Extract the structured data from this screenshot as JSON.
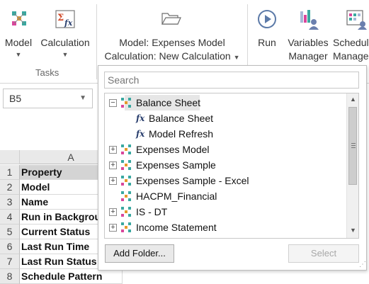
{
  "ribbon": {
    "model_button": {
      "label": "Model",
      "icon": "model-icon"
    },
    "calculation_button": {
      "label": "Calculation",
      "icon": "calculation-sigma-fx-icon"
    },
    "group_tasks_label": "Tasks",
    "selector": {
      "line1": "Model: Expenses Model",
      "line2": "Calculation: New Calculation",
      "icon": "folder-open-icon"
    },
    "run_button": {
      "label": "Run",
      "icon": "play-circle-icon"
    },
    "variables_manager_button": {
      "line1": "Variables",
      "line2": "Manager",
      "icon": "variables-icon"
    },
    "schedule_manager_button": {
      "line1": "Schedule",
      "line2": "Manager",
      "icon": "schedule-icon"
    }
  },
  "namebox": {
    "value": "B5"
  },
  "sheet": {
    "column_header": "A",
    "rows": [
      {
        "num": "1",
        "value": "Property",
        "highlight": true
      },
      {
        "num": "2",
        "value": "Model"
      },
      {
        "num": "3",
        "value": "Name"
      },
      {
        "num": "4",
        "value": "Run in Background"
      },
      {
        "num": "5",
        "value": "Current Status"
      },
      {
        "num": "6",
        "value": "Last Run Time"
      },
      {
        "num": "7",
        "value": "Last Run Status"
      },
      {
        "num": "8",
        "value": "Schedule Pattern"
      }
    ]
  },
  "popup": {
    "search_placeholder": "Search",
    "tree": [
      {
        "label": "Balance Sheet",
        "type": "model",
        "expanded": true,
        "level": 0,
        "selected": true
      },
      {
        "label": "Balance Sheet",
        "type": "calculation",
        "level": 1
      },
      {
        "label": "Model Refresh",
        "type": "calculation",
        "level": 1
      },
      {
        "label": "Expenses Model",
        "type": "model",
        "expanded": false,
        "level": 0
      },
      {
        "label": "Expenses Sample",
        "type": "model",
        "expanded": false,
        "level": 0
      },
      {
        "label": "Expenses Sample - Excel",
        "type": "model",
        "expanded": false,
        "level": 0
      },
      {
        "label": "HACPM_Financial",
        "type": "model",
        "level": 0
      },
      {
        "label": "IS - DT",
        "type": "model",
        "expanded": false,
        "level": 0
      },
      {
        "label": "Income Statement",
        "type": "model",
        "expanded": false,
        "level": 0
      }
    ],
    "add_folder_label": "Add Folder...",
    "select_label": "Select"
  },
  "colors": {
    "model_icon_teal": "#3aa8a0",
    "model_icon_orange": "#e69a2a",
    "model_icon_pink": "#d9469b",
    "fx_icon": "#2a3f6e",
    "selection": "#e6e6e6"
  }
}
